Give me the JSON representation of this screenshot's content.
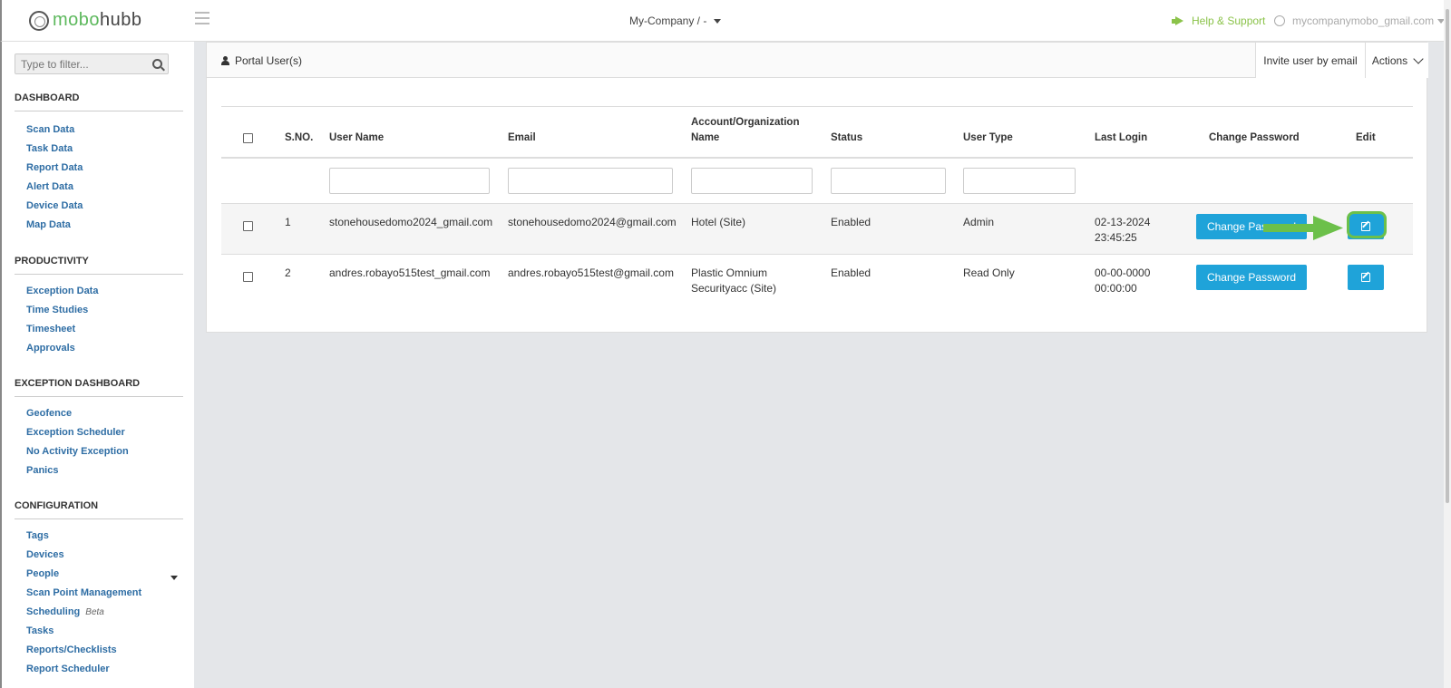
{
  "topbar": {
    "logo_part1": "mobo",
    "logo_part2": "hubb",
    "company": "My-Company / -",
    "help": "Help & Support",
    "user": "mycompanymobo_gmail.com"
  },
  "sidebar": {
    "filter_placeholder": "Type to filter...",
    "sections": {
      "dashboard": {
        "title": "DASHBOARD",
        "items": [
          "Scan Data",
          "Task Data",
          "Report Data",
          "Alert Data",
          "Device Data",
          "Map Data"
        ]
      },
      "productivity": {
        "title": "PRODUCTIVITY",
        "items": [
          "Exception Data",
          "Time Studies",
          "Timesheet",
          "Approvals"
        ]
      },
      "exception": {
        "title": "EXCEPTION DASHBOARD",
        "items": [
          "Geofence",
          "Exception Scheduler",
          "No Activity Exception",
          "Panics"
        ]
      },
      "configuration": {
        "title": "CONFIGURATION",
        "items": [
          "Tags",
          "Devices",
          "People",
          "Scan Point Management",
          "Scheduling",
          "Tasks",
          "Reports/Checklists",
          "Report Scheduler"
        ],
        "beta_label": "Beta"
      }
    }
  },
  "panel": {
    "title": "Portal User(s)",
    "invite": "Invite user by email",
    "actions": "Actions"
  },
  "table": {
    "headers": {
      "sno": "S.NO.",
      "username": "User Name",
      "email": "Email",
      "account_l1": "Account/Organization",
      "account_l2": "Name",
      "status": "Status",
      "usertype": "User Type",
      "lastlogin": "Last Login",
      "changepw": "Change Password",
      "edit": "Edit"
    },
    "rows": [
      {
        "sno": "1",
        "username": "stonehousedomo2024_gmail.com",
        "email": "stonehousedomo2024@gmail.com",
        "account_l1": "Hotel (Site)",
        "account_l2": "",
        "status": "Enabled",
        "usertype": "Admin",
        "login_date": "02-13-2024",
        "login_time": "23:45:25",
        "changepw": "Change Password"
      },
      {
        "sno": "2",
        "username": "andres.robayo515test_gmail.com",
        "email": "andres.robayo515test@gmail.com",
        "account_l1": "Plastic Omnium",
        "account_l2": "Securityacc (Site)",
        "status": "Enabled",
        "usertype": "Read Only",
        "login_date": "00-00-0000",
        "login_time": "00:00:00",
        "changepw": "Change Password"
      }
    ]
  },
  "colors": {
    "accent": "#1fa3d9",
    "highlight": "#6cc04a",
    "link": "#2e6da4"
  }
}
